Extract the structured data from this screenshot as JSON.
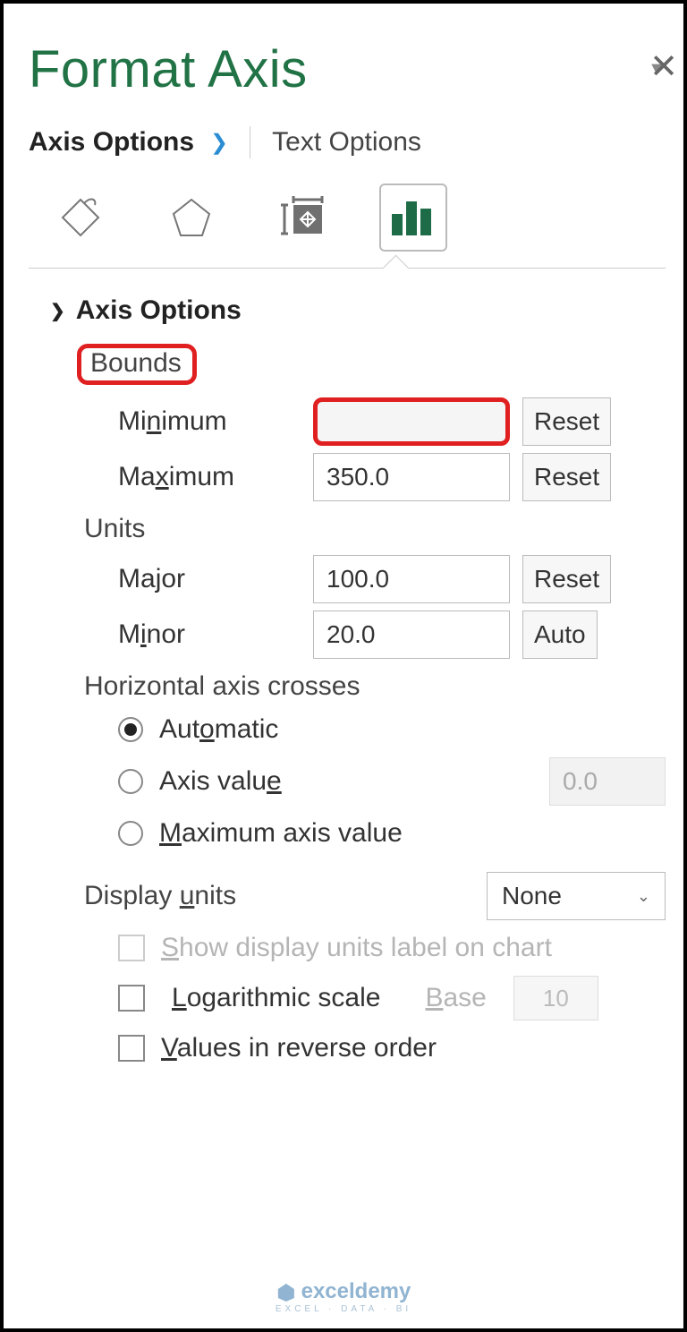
{
  "title": "Format Axis",
  "tabs": {
    "axis_options": "Axis Options",
    "text_options": "Text Options"
  },
  "section_header": "Axis Options",
  "bounds": {
    "label": "Bounds",
    "minimum_label": "Minimum",
    "minimum_value": "",
    "minimum_btn": "Reset",
    "maximum_label": "Maximum",
    "maximum_value": "350.0",
    "maximum_btn": "Reset"
  },
  "units": {
    "label": "Units",
    "major_label": "Major",
    "major_value": "100.0",
    "major_btn": "Reset",
    "minor_label": "Minor",
    "minor_value": "20.0",
    "minor_btn": "Auto"
  },
  "crosses": {
    "label": "Horizontal axis crosses",
    "automatic": "Automatic",
    "axis_value": "Axis value",
    "axis_value_num": "0.0",
    "max_axis_value": "Maximum axis value"
  },
  "display_units": {
    "label": "Display units",
    "selected": "None",
    "show_label": "Show display units label on chart"
  },
  "log_scale": {
    "label": "Logarithmic scale",
    "base_label": "Base",
    "base_value": "10"
  },
  "reverse": {
    "label": "Values in reverse order"
  },
  "watermark": {
    "main": "exceldemy",
    "sub": "EXCEL · DATA · BI"
  }
}
